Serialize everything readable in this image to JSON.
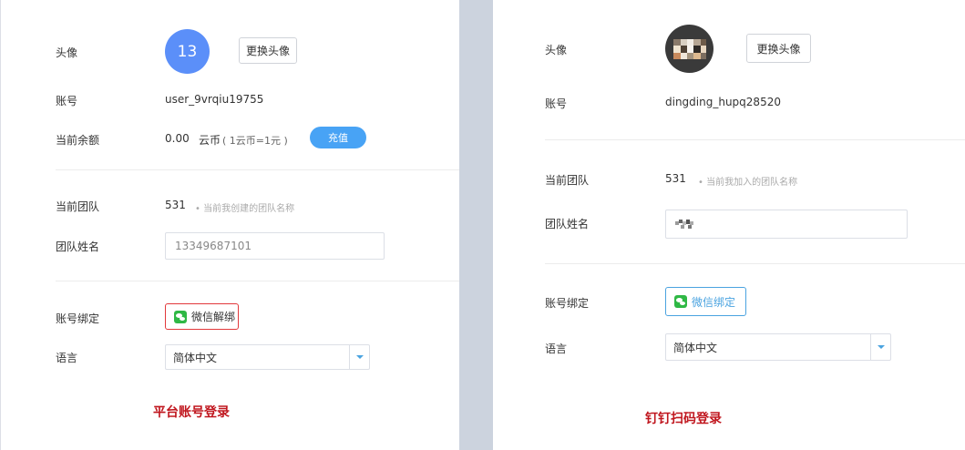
{
  "left": {
    "avatar_label": "头像",
    "avatar_text": "13",
    "change_avatar_button": "更换头像",
    "account_label": "账号",
    "account_value": "user_9vrqiu19755",
    "balance_label": "当前余额",
    "balance_value": "0.00",
    "balance_unit": "云币",
    "balance_rate": "( 1云币=1元 )",
    "recharge_button": "充值",
    "team_label": "当前团队",
    "team_value": "531",
    "team_hint": "• 当前我创建的团队名称",
    "team_name_label": "团队姓名",
    "team_name_value": "13349687101",
    "binding_label": "账号绑定",
    "wechat_button": "微信解绑",
    "language_label": "语言",
    "language_value": "简体中文",
    "caption": "平台账号登录"
  },
  "right": {
    "avatar_label": "头像",
    "change_avatar_button": "更换头像",
    "account_label": "账号",
    "account_value": "dingding_hupq28520",
    "team_label": "当前团队",
    "team_value": "531",
    "team_hint": "• 当前我加入的团队名称",
    "team_name_label": "团队姓名",
    "binding_label": "账号绑定",
    "wechat_button": "微信绑定",
    "language_label": "语言",
    "language_value": "简体中文",
    "caption": "钉钉扫码登录"
  },
  "colors": {
    "background_gap": "#ccd3de",
    "accent_blue": "#48a3f5",
    "avatar_blue": "#5b8ff9",
    "unbind_red": "#e2383b",
    "wechat_green": "#2fb845",
    "caption_red": "#c0161e"
  }
}
